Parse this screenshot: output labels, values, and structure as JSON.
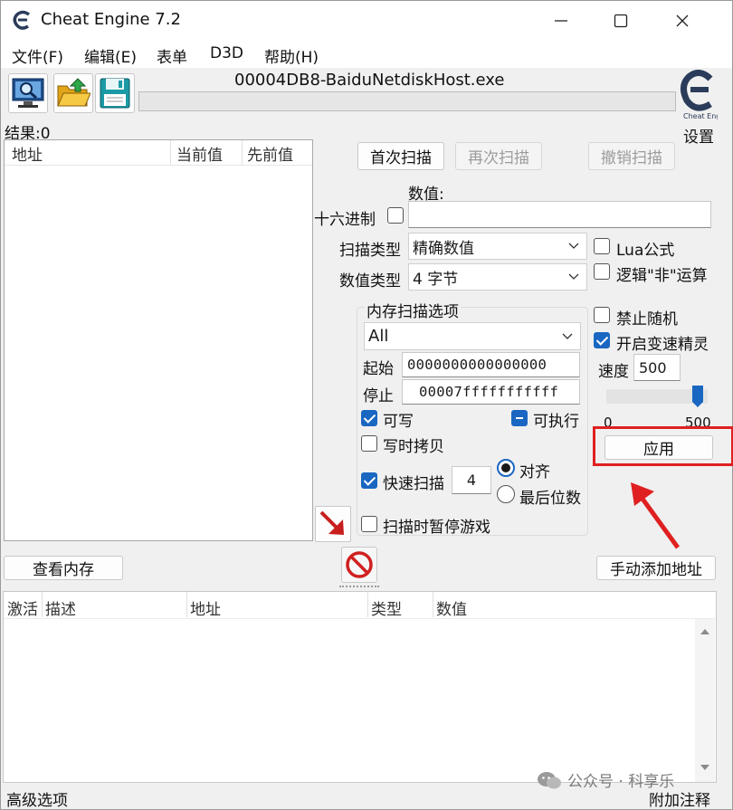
{
  "window": {
    "title": "Cheat Engine 7.2"
  },
  "menu": [
    "文件(F)",
    "编辑(E)",
    "表单",
    "D3D",
    "帮助(H)"
  ],
  "toolbar": {
    "process_name": "00004DB8-BaiduNetdiskHost.exe",
    "settings_label": "设置"
  },
  "results": {
    "label": "结果:0"
  },
  "address_list": {
    "columns": [
      "地址",
      "当前值",
      "先前值"
    ]
  },
  "scan": {
    "first_scan": "首次扫描",
    "next_scan": "再次扫描",
    "undo_scan": "撤销扫描",
    "value_label": "数值:",
    "hex_label": "十六进制",
    "value_input": "",
    "scan_type_label": "扫描类型",
    "scan_type_value": "精确数值",
    "value_type_label": "数值类型",
    "value_type_value": "4 字节",
    "lua_label": "Lua公式",
    "not_label": "逻辑\"非\"运算"
  },
  "memory_options": {
    "title": "内存扫描选项",
    "region": "All",
    "start_label": "起始",
    "start_value": "0000000000000000",
    "stop_label": "停止",
    "stop_value": "00007fffffffffff",
    "writable": "可写",
    "executable": "可执行",
    "copy_on_write": "写时拷贝",
    "fast_scan": "快速扫描",
    "fast_scan_value": "4",
    "align": "对齐",
    "last_digits": "最后位数",
    "pause_game": "扫描时暂停游戏"
  },
  "speedhack": {
    "disable_random": "禁止随机",
    "enable_speedhack": "开启变速精灵",
    "speed_label": "速度",
    "speed_value": "500",
    "slider_min": "0",
    "slider_max": "500",
    "slider_level": 1.0,
    "apply": "应用"
  },
  "bottom": {
    "view_memory": "查看内存",
    "add_address": "手动添加地址",
    "columns": [
      "激活",
      "描述",
      "地址",
      "类型",
      "数值"
    ],
    "advanced": "高级选项",
    "comments": "附加注释"
  },
  "watermark": "公众号 · 科享乐",
  "colors": {
    "accent": "#1a67c2",
    "highlight": "#e02020"
  }
}
